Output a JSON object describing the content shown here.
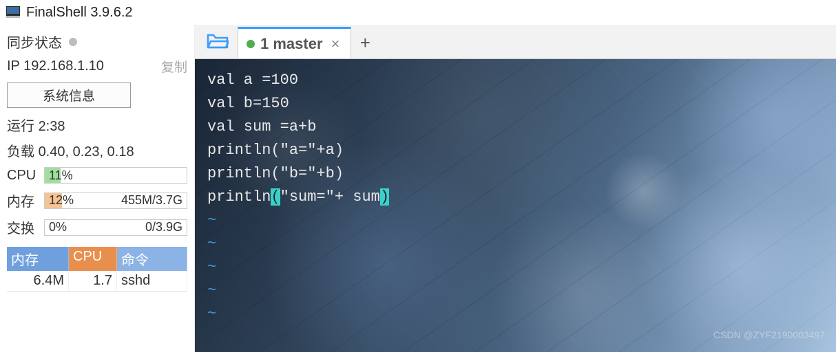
{
  "title": "FinalShell 3.9.6.2",
  "sidebar": {
    "sync_label": "同步状态",
    "ip_label": "IP",
    "ip_value": "192.168.1.10",
    "copy_label": "复制",
    "sysinfo_label": "系统信息",
    "uptime_label": "运行",
    "uptime_value": "2:38",
    "load_label": "负载",
    "load_value": "0.40, 0.23, 0.18",
    "cpu_label": "CPU",
    "cpu_pct": "11%",
    "mem_label": "内存",
    "mem_pct": "12%",
    "mem_detail": "455M/3.7G",
    "swap_label": "交换",
    "swap_pct": "0%",
    "swap_detail": "0/3.9G"
  },
  "proc_headers": {
    "mem": "内存",
    "cpu": "CPU",
    "cmd": "命令"
  },
  "proc": [
    {
      "mem": "6.4M",
      "cpu": "1.7",
      "cmd": "sshd"
    }
  ],
  "tabs": [
    {
      "label": "1 master"
    }
  ],
  "terminal_lines": [
    "val a =100",
    "val b=150",
    "val sum =a+b",
    "println(\"a=\"+a)",
    "println(\"b=\"+b)"
  ],
  "terminal_last": {
    "pre": "println",
    "open": "(",
    "mid": "\"sum=\"+ sum",
    "close": ")"
  },
  "watermark": "CSDN @ZYF2190003497"
}
